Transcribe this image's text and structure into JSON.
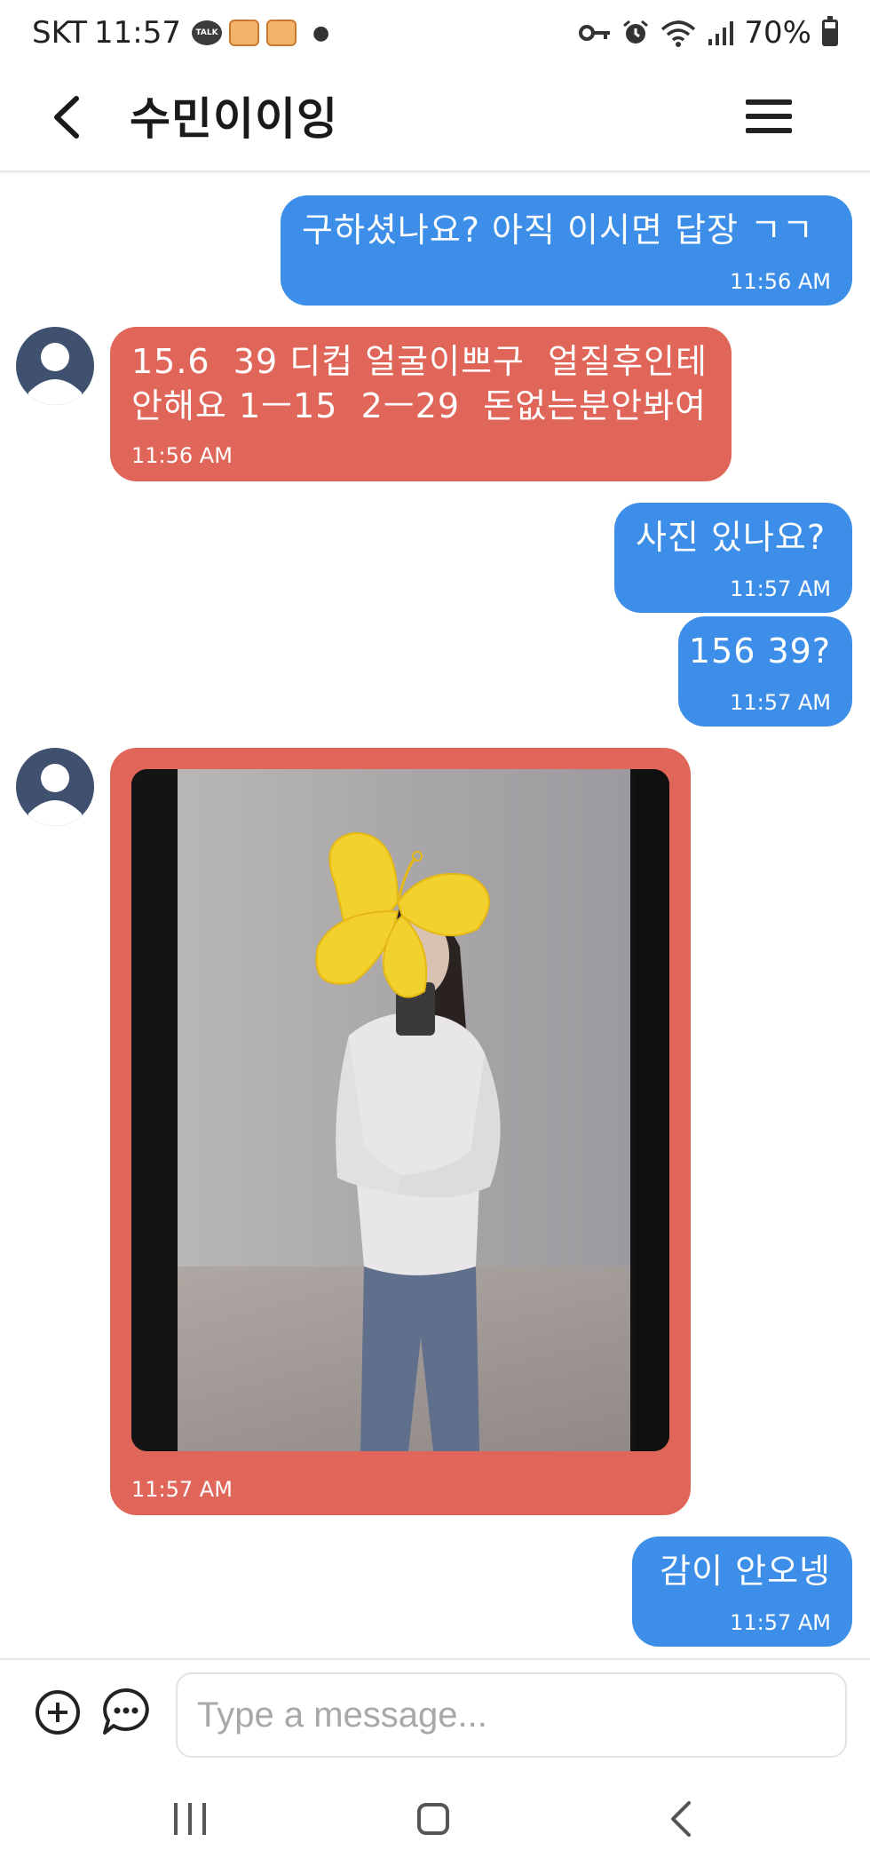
{
  "status_bar": {
    "carrier": "SKT",
    "time": "11:57",
    "talk_badge": "TALK",
    "battery": "70%",
    "battery_level": 0.7,
    "icons": [
      "kakaotalk-icon",
      "notification-app-icon",
      "notification-app-icon",
      "vpn-key-icon",
      "alarm-icon",
      "wifi-icon",
      "signal-icon",
      "battery-icon"
    ]
  },
  "header": {
    "title": "수민이이잉",
    "back_icon": "chevron-left-icon",
    "menu_icon": "hamburger-menu-icon"
  },
  "messages": [
    {
      "direction": "out",
      "text": "구하셨나요? 아직 이시면 답장 ㄱㄱ",
      "time": "11:56 AM"
    },
    {
      "direction": "in",
      "text": "15.6  39 디컵 얼굴이쁘구  얼질후인테\n안해요 1ㅡ15  2ㅡ29  돈없는분안봐여",
      "time": "11:56 AM"
    },
    {
      "direction": "out",
      "text": "사진 있나요?",
      "time": "11:57 AM"
    },
    {
      "direction": "out",
      "text": "156 39?",
      "time": "11:57 AM"
    },
    {
      "direction": "in",
      "type": "photo",
      "time": "11:57 AM"
    },
    {
      "direction": "out",
      "text": "감이 안오넹",
      "time": "11:57 AM"
    }
  ],
  "composer": {
    "placeholder": "Type a message...",
    "add_icon": "plus-circle-icon",
    "emoji_icon": "chat-bubble-icon"
  },
  "nav_bar": {
    "icons": [
      "recent-apps-icon",
      "home-icon",
      "back-icon"
    ]
  },
  "colors": {
    "outgoing_bubble": "#3d8ee8",
    "incoming_bubble": "#e0665a",
    "avatar": "#3f516e"
  }
}
